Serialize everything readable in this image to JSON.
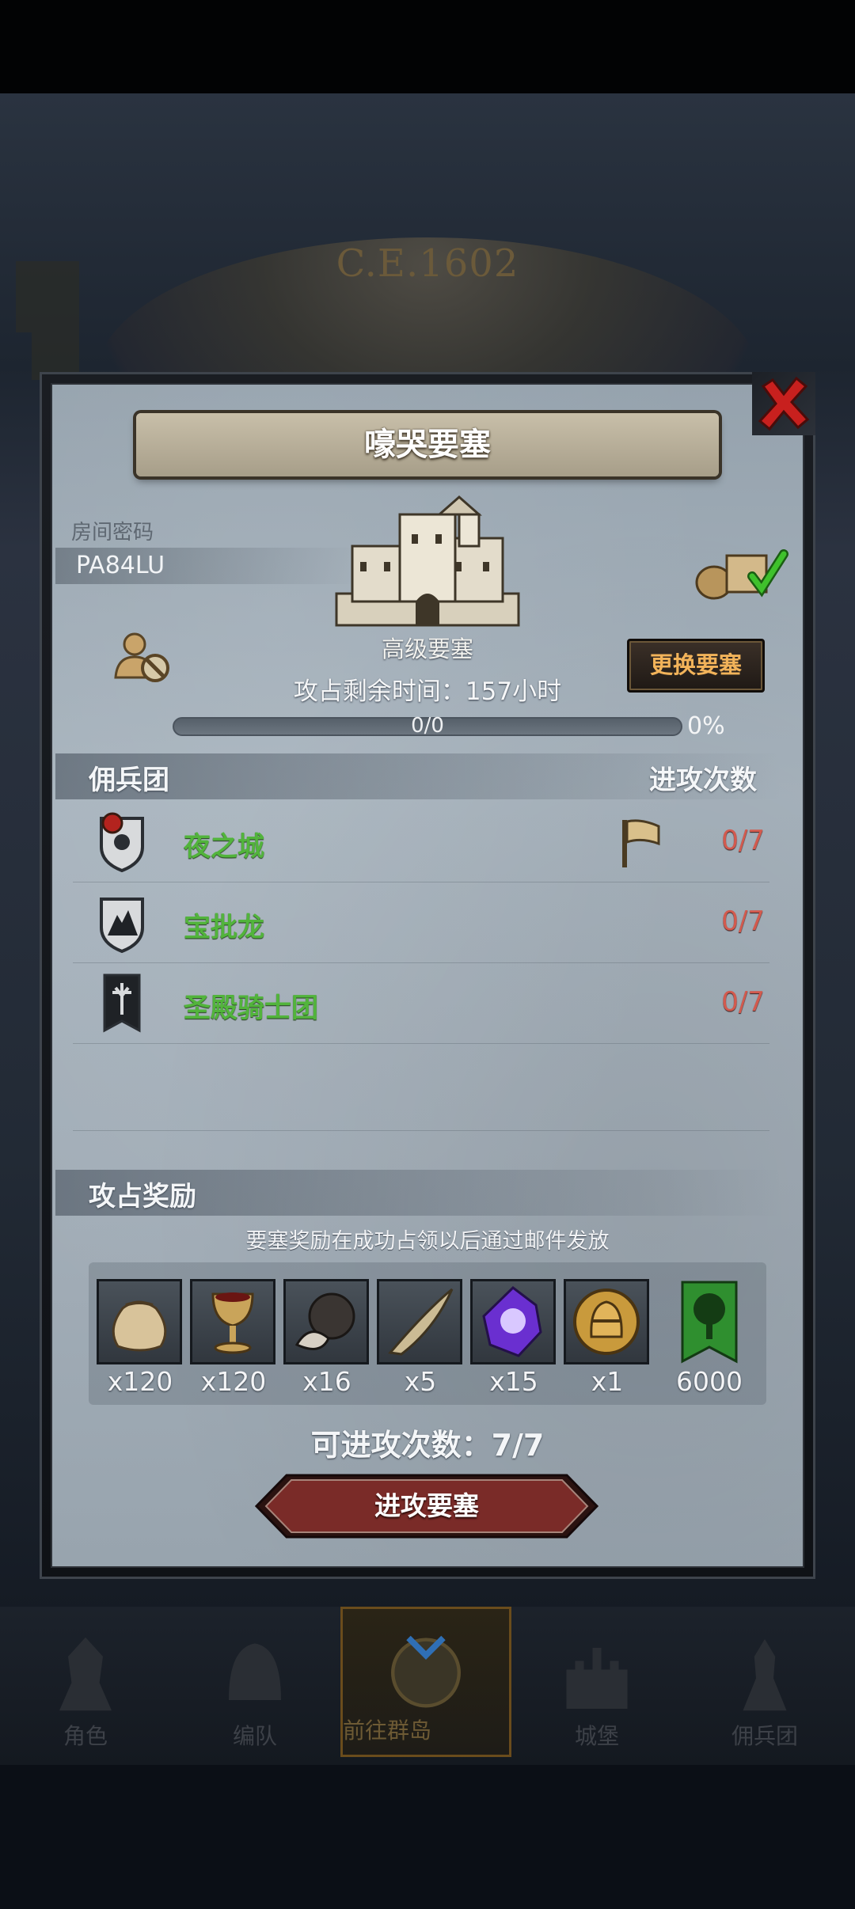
{
  "background": {
    "era_label": "C.E.1602"
  },
  "modal": {
    "title": "嚎哭要塞",
    "room_code_label": "房间密码",
    "room_code": "PA84LU",
    "fortress_level": "高级要塞",
    "time_remaining": "攻占剩余时间：157小时",
    "change_fortress_button": "更换要塞",
    "progress": {
      "text": "0/0",
      "percent_label": "0%",
      "fraction": 0
    }
  },
  "mercenary_section": {
    "title": "佣兵团",
    "attack_count_header": "进攻次数",
    "rows": [
      {
        "name": "夜之城",
        "count": "0/7",
        "badge": "red-emblem-shield-icon",
        "flag": true
      },
      {
        "name": "宝批龙",
        "count": "0/7",
        "badge": "mountain-shield-icon",
        "flag": false
      },
      {
        "name": "圣殿骑士团",
        "count": "0/7",
        "badge": "sword-banner-icon",
        "flag": false
      }
    ]
  },
  "rewards_section": {
    "title": "攻占奖励",
    "note": "要塞奖励在成功占领以后通过邮件发放",
    "items": [
      {
        "icon": "coin-sack-icon",
        "quantity": "x120"
      },
      {
        "icon": "goblet-icon",
        "quantity": "x120"
      },
      {
        "icon": "truffle-icon",
        "quantity": "x16"
      },
      {
        "icon": "horn-icon",
        "quantity": "x5"
      },
      {
        "icon": "purple-crystal-icon",
        "quantity": "x15"
      },
      {
        "icon": "knight-helmet-medal-icon",
        "quantity": "x1"
      },
      {
        "icon": "tree-banner-icon",
        "quantity": "6000"
      }
    ]
  },
  "attack": {
    "count_text": "可进攻次数：7/7",
    "button_label": "进攻要塞"
  },
  "bottom_nav": {
    "items": [
      {
        "label": "角色",
        "icon": "knight-icon"
      },
      {
        "label": "编队",
        "icon": "helmet-icon"
      },
      {
        "label": "前往群岛",
        "icon": "globe-icon",
        "active": true
      },
      {
        "label": "城堡",
        "icon": "castle-icon"
      },
      {
        "label": "佣兵团",
        "icon": "soldier-icon"
      }
    ]
  },
  "colors": {
    "merc_name": "#52b43c",
    "attack_count": "#d35a4e",
    "change_button_text": "#f2b35a",
    "attack_button": "#7a2b28"
  }
}
